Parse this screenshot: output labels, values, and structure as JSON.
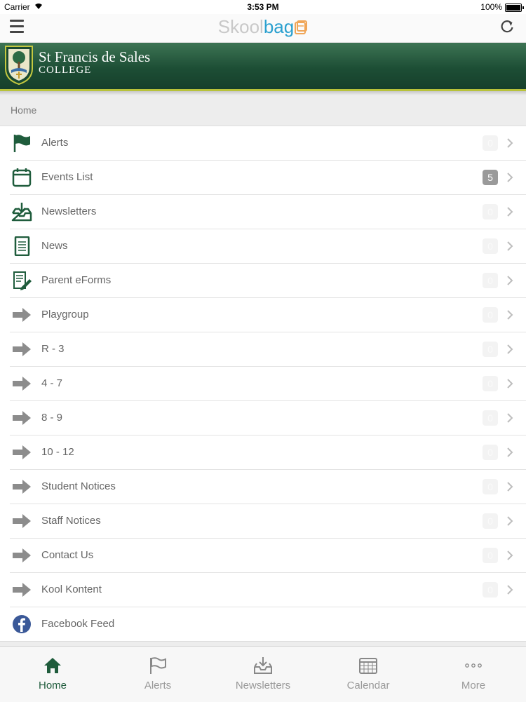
{
  "status_bar": {
    "carrier": "Carrier",
    "time": "3:53 PM",
    "battery": "100%"
  },
  "nav": {
    "brand_part1": "Skool",
    "brand_part2": "bag"
  },
  "school": {
    "name": "St Francis de Sales",
    "subtitle": "COLLEGE"
  },
  "breadcrumb": "Home",
  "menu_items": [
    {
      "label": "Alerts",
      "badge": "0",
      "icon": "flag-icon"
    },
    {
      "label": "Events List",
      "badge": "5",
      "icon": "calendar-icon"
    },
    {
      "label": "Newsletters",
      "badge": "0",
      "icon": "inbox-download-icon"
    },
    {
      "label": "News",
      "badge": "0",
      "icon": "document-icon"
    },
    {
      "label": "Parent eForms",
      "badge": "0",
      "icon": "form-pen-icon"
    },
    {
      "label": "Playgroup",
      "badge": "0",
      "icon": "arrow-right-icon"
    },
    {
      "label": "R - 3",
      "badge": "0",
      "icon": "arrow-right-icon"
    },
    {
      "label": "4 - 7",
      "badge": "0",
      "icon": "arrow-right-icon"
    },
    {
      "label": "8 - 9",
      "badge": "0",
      "icon": "arrow-right-icon"
    },
    {
      "label": "10 - 12",
      "badge": "0",
      "icon": "arrow-right-icon"
    },
    {
      "label": "Student Notices",
      "badge": "0",
      "icon": "arrow-right-icon"
    },
    {
      "label": "Staff Notices",
      "badge": "0",
      "icon": "arrow-right-icon"
    },
    {
      "label": "Contact Us",
      "badge": "0",
      "icon": "arrow-right-icon"
    },
    {
      "label": "Kool Kontent",
      "badge": "0",
      "icon": "arrow-right-icon"
    },
    {
      "label": "Facebook Feed",
      "icon": "facebook-icon"
    }
  ],
  "tabs": [
    {
      "label": "Home",
      "icon": "home-icon",
      "active": true
    },
    {
      "label": "Alerts",
      "icon": "flag-icon"
    },
    {
      "label": "Newsletters",
      "icon": "inbox-download-icon"
    },
    {
      "label": "Calendar",
      "icon": "calendar-grid-icon"
    },
    {
      "label": "More",
      "icon": "more-dots-icon"
    }
  ],
  "colors": {
    "brand_green": "#1f5c3c",
    "banner_accent": "#b8c23a",
    "skool_gray": "#c9c9c9",
    "bag_blue": "#2aa0cf",
    "facebook_blue": "#3b5998"
  }
}
